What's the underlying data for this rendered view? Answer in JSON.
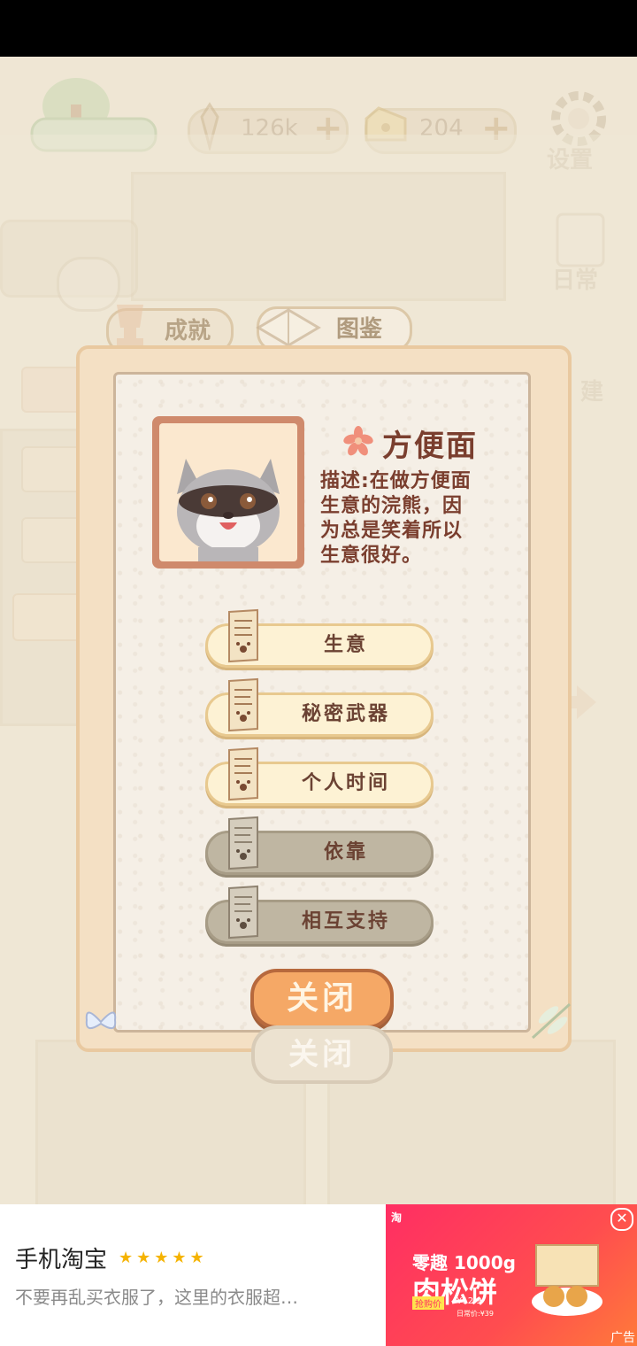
{
  "hud": {
    "fish_value": "126k",
    "cheese_value": "204",
    "settings_label": "设置",
    "daily_label": "日常",
    "build_label": "建"
  },
  "tabs": {
    "achievements": "成就",
    "encyclopedia": "图鉴"
  },
  "character": {
    "name": "方便面",
    "description_lines": [
      "描述:在做方便面",
      "生意的浣熊，因",
      "为总是笑着所以",
      "生意很好。"
    ]
  },
  "stories": [
    {
      "label": "生意",
      "unlocked": true
    },
    {
      "label": "秘密武器",
      "unlocked": true
    },
    {
      "label": "个人时间",
      "unlocked": true
    },
    {
      "label": "依靠",
      "unlocked": false
    },
    {
      "label": "相互支持",
      "unlocked": false
    }
  ],
  "close_label": "关闭",
  "ad": {
    "app_name": "手机淘宝",
    "rating_stars": "★★★★★",
    "description": "不要再乱买衣服了，这里的衣服超…",
    "image_brand": "淘",
    "image_headline": "零趣 1000g",
    "image_product": "肉松饼",
    "image_badge": "抢购价",
    "image_price": "¥12.9",
    "image_orig_price": "日常价:¥39",
    "ad_label": "广告"
  },
  "colors": {
    "accent_orange": "#f5a866",
    "text_brown": "#7a3e2e",
    "locked_gray": "#bfb6a2"
  }
}
